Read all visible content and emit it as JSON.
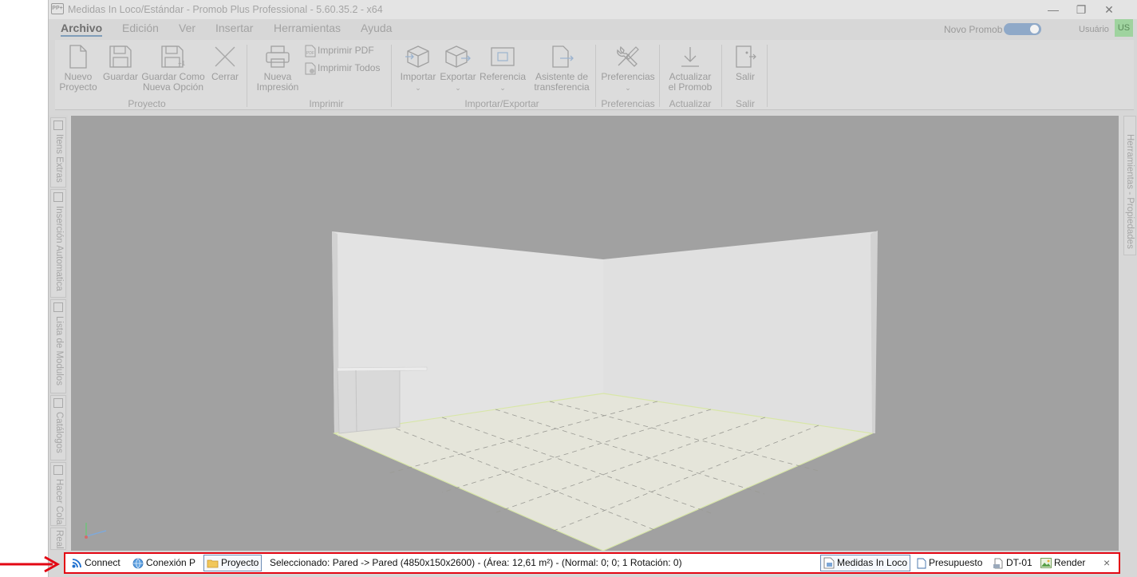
{
  "window": {
    "title": "Medidas In Loco/Estándar - Promob Plus Professional - 5.60.35.2 - x64",
    "logo_text": "PP+",
    "minimize": "—",
    "restore": "❐",
    "close": "✕"
  },
  "menu": {
    "items": [
      {
        "label": "Archivo",
        "active": true
      },
      {
        "label": "Edición"
      },
      {
        "label": "Ver"
      },
      {
        "label": "Insertar"
      },
      {
        "label": "Herramientas"
      },
      {
        "label": "Ayuda"
      }
    ],
    "novo_promob": "Novo Promob",
    "user": "Usuário",
    "avatar": "US"
  },
  "ribbon": {
    "proyecto": {
      "label": "Proyecto",
      "nuevo": [
        "Nuevo",
        "Proyecto"
      ],
      "guardar": "Guardar",
      "guardar_como": [
        "Guardar Como",
        "Nueva Opción"
      ],
      "cerrar": "Cerrar"
    },
    "imprimir": {
      "label": "Imprimir",
      "nueva": [
        "Nueva",
        "Impresión"
      ],
      "pdf": "Imprimir PDF",
      "todos": "Imprimir Todos"
    },
    "importar_exportar": {
      "label": "Importar/Exportar",
      "importar": "Importar",
      "exportar": "Exportar",
      "referencia": "Referencia",
      "asistente": [
        "Asistente de",
        "transferencia"
      ]
    },
    "preferencias": {
      "label": "Preferencias",
      "btn": "Preferencias"
    },
    "actualizar": {
      "label": "Actualizar",
      "btn": [
        "Actualizar",
        "el Promob"
      ]
    },
    "salir": {
      "label": "Salir",
      "btn": "Salir"
    },
    "chevron": "⌄"
  },
  "left_tabs": [
    "Itens Extras",
    "Inserción Automatica",
    "Lista de Modulos",
    "Catálogos",
    "Hacer Cola",
    "Real"
  ],
  "right_tab": "Herramientas - Propiedades",
  "statusbar": {
    "connect": "Connect",
    "conexion": "Conexión P",
    "proyecto": "Proyecto",
    "selection": "Seleccionado: Pared -> Pared (4850x150x2600) - (Área: 12,61 m²) - (Normal: 0; 0; 1 Rotación: 0)",
    "medidas": "Medidas In Loco",
    "presupuesto": "Presupuesto",
    "dt": "DT-01",
    "render": "Render",
    "close": "×"
  },
  "colors": {
    "highlight": "#e30613",
    "accent": "#8fa9c8"
  }
}
